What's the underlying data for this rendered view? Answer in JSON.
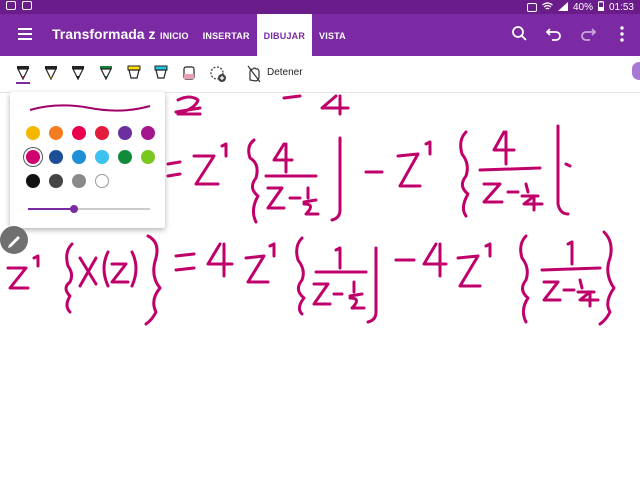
{
  "statusbar": {
    "battery": "40%",
    "time": "01:53"
  },
  "appbar": {
    "title": "Transformada z",
    "tabs": [
      {
        "label": "INICIO",
        "active": false
      },
      {
        "label": "INSERTAR",
        "active": false
      },
      {
        "label": "DIBUJAR",
        "active": true
      },
      {
        "label": "VISTA",
        "active": false
      }
    ],
    "icons": [
      "search-icon",
      "undo-icon",
      "redo-icon",
      "more-icon"
    ]
  },
  "toolbar": {
    "pens": [
      {
        "name": "pen-red",
        "color": "#d81b60"
      },
      {
        "name": "pen-yellow",
        "color": "#f0c000"
      },
      {
        "name": "pen-black",
        "color": "#111111"
      },
      {
        "name": "pen-green",
        "color": "#1a7f37"
      },
      {
        "name": "highlighter-yellow",
        "color": "#ffe000"
      },
      {
        "name": "highlighter-cyan",
        "color": "#22c6e0"
      },
      {
        "name": "eraser",
        "color": "#cc7788"
      },
      {
        "name": "lasso",
        "color": "#444444"
      }
    ],
    "stop_label": "Detener"
  },
  "palette": {
    "stroke_color": "#a0006a",
    "colors": [
      "#f5b700",
      "#f57c20",
      "#e8004f",
      "#e31b3c",
      "#6b2fa0",
      "#a2188c",
      "#d0006f",
      "#1f4e99",
      "#1e90d8",
      "#3cc2f0",
      "#118a3a",
      "#7ac71f",
      "#111111",
      "#444444",
      "#8a8a8a",
      "#ffffff"
    ],
    "selected_index": 6,
    "thickness": 0.38
  },
  "ink_color": "#c0006a"
}
